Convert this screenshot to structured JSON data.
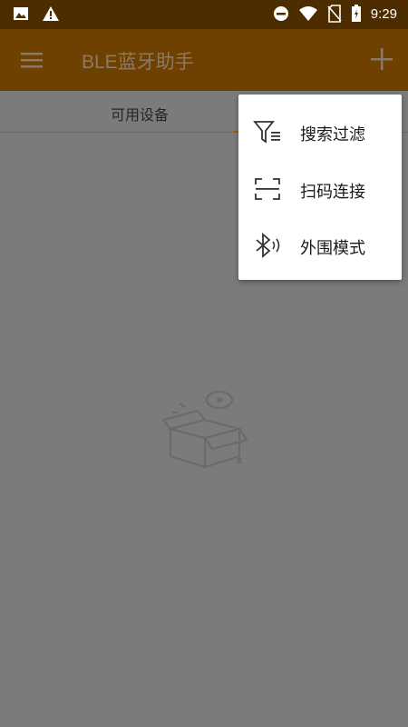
{
  "status_bar": {
    "time": "9:29",
    "icons": [
      "image-icon",
      "warning-icon",
      "do-not-disturb-icon",
      "wifi-icon",
      "no-sim-icon",
      "battery-icon"
    ]
  },
  "app_bar": {
    "title": "BLE蓝牙助手",
    "menu_icon": "hamburger-menu-icon",
    "add_icon": "plus-icon"
  },
  "tabs": [
    {
      "label": "可用设备"
    }
  ],
  "popup_menu": {
    "items": [
      {
        "label": "搜索过滤",
        "icon": "filter-icon"
      },
      {
        "label": "扫码连接",
        "icon": "scan-icon"
      },
      {
        "label": "外围模式",
        "icon": "bluetooth-broadcast-icon"
      }
    ]
  },
  "colors": {
    "status_bar": "#4d2d00",
    "app_bar": "#6e4100",
    "scrim_background": "#7b7b7b",
    "popup_background": "#ffffff"
  }
}
